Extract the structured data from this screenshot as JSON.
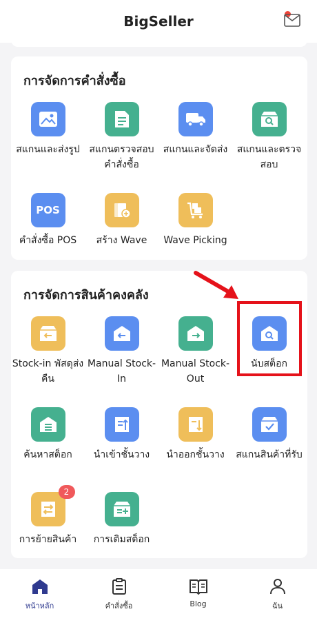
{
  "header": {
    "title": "BigSeller",
    "mail_icon": "mail-icon"
  },
  "order_section": {
    "title": "การจัดการคำสั่งซื้อ",
    "items": [
      {
        "label": "สแกนและส่งรูป",
        "icon": "image-icon",
        "color": "#5b8ef0"
      },
      {
        "label": "สแกนตรวจสอบคำสั่งซื้อ",
        "icon": "document-list-icon",
        "color": "#45b08f"
      },
      {
        "label": "สแกนและจัดส่ง",
        "icon": "truck-icon",
        "color": "#5b8ef0"
      },
      {
        "label": "สแกนและตรวจสอบ",
        "icon": "box-search-icon",
        "color": "#45b08f"
      },
      {
        "label": "คำสั่งซื้อ POS",
        "icon": "pos-icon",
        "icon_text": "POS",
        "color": "#5b8ef0"
      },
      {
        "label": "สร้าง Wave",
        "icon": "wave-add-icon",
        "color": "#efbe5a"
      },
      {
        "label": "Wave Picking",
        "icon": "cart-icon",
        "color": "#efbe5a"
      }
    ]
  },
  "inventory_section": {
    "title": "การจัดการสินค้าคงคลัง",
    "items": [
      {
        "label": "Stock-in พัสดุส่งคืน",
        "icon": "return-box-icon",
        "color": "#efbe5a"
      },
      {
        "label": "Manual Stock-In",
        "icon": "warehouse-in-icon",
        "color": "#5b8ef0"
      },
      {
        "label": "Manual Stock-Out",
        "icon": "warehouse-out-icon",
        "color": "#45b08f"
      },
      {
        "label": "นับสต็อก",
        "icon": "warehouse-search-icon",
        "color": "#5b8ef0"
      },
      {
        "label": "ค้นหาสต็อก",
        "icon": "warehouse-list-icon",
        "color": "#45b08f"
      },
      {
        "label": "นำเข้าชั้นวาง",
        "icon": "shelf-in-icon",
        "color": "#5b8ef0"
      },
      {
        "label": "นำออกชั้นวาง",
        "icon": "shelf-out-icon",
        "color": "#efbe5a"
      },
      {
        "label": "สแกนสินค้าที่รับ",
        "icon": "box-check-icon",
        "color": "#5b8ef0"
      },
      {
        "label": "การย้ายสินค้า",
        "icon": "shelf-transfer-icon",
        "color": "#efbe5a",
        "badge": "2"
      },
      {
        "label": "การเติมสต็อก",
        "icon": "replenish-icon",
        "color": "#45b08f"
      }
    ]
  },
  "tabbar": {
    "items": [
      {
        "label": "หน้าหลัก",
        "icon": "home-icon",
        "active": true
      },
      {
        "label": "คำสั่งซื้อ",
        "icon": "clipboard-icon",
        "active": false
      },
      {
        "label": "Blog",
        "icon": "book-icon",
        "active": false
      },
      {
        "label": "ฉัน",
        "icon": "user-icon",
        "active": false
      }
    ]
  },
  "colors": {
    "accent": "#2f3a8f",
    "highlight": "#e5121a",
    "badge": "#f0595b"
  }
}
